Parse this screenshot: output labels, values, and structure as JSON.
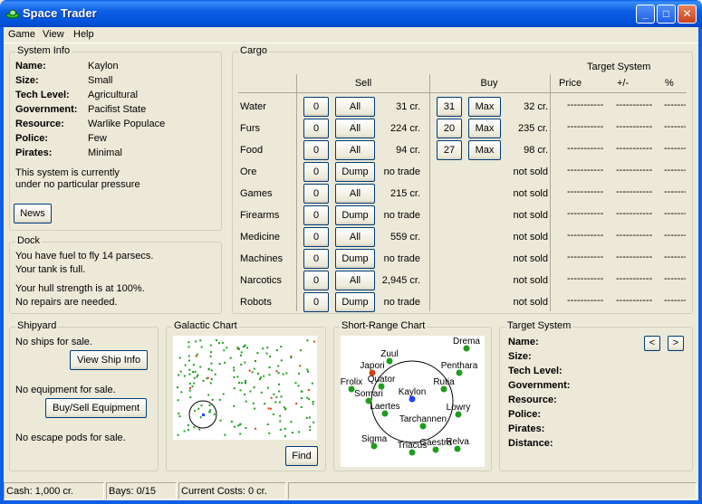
{
  "window": {
    "title": "Space Trader",
    "minimize": "_",
    "maximize": "□",
    "close": "✕"
  },
  "menu": [
    "Game",
    "View",
    "Help"
  ],
  "system_info": {
    "title": "System Info",
    "rows": [
      {
        "label": "Name:",
        "value": "Kaylon"
      },
      {
        "label": "Size:",
        "value": "Small"
      },
      {
        "label": "Tech Level:",
        "value": "Agricultural"
      },
      {
        "label": "Government:",
        "value": "Pacifist State"
      },
      {
        "label": "Resource:",
        "value": "Warlike Populace"
      },
      {
        "label": "Police:",
        "value": "Few"
      },
      {
        "label": "Pirates:",
        "value": "Minimal"
      }
    ],
    "status_line1": "This system is currently",
    "status_line2": "under no particular pressure",
    "news_button": "News"
  },
  "dock": {
    "title": "Dock",
    "fuel_text": "You have fuel to fly 14 parsecs.",
    "tank_text": "Your tank is full.",
    "hull_text": "Your hull strength is at 100%.",
    "repair_text": "No repairs are needed."
  },
  "cargo": {
    "title": "Cargo",
    "sell_header": "Sell",
    "buy_header": "Buy",
    "target_header": "Target System",
    "price_header": "Price",
    "diff_header": "+/-",
    "pct_header": "%",
    "dash": "-----------",
    "rows": [
      {
        "name": "Water",
        "sell_qty": "0",
        "sell_btn": "All",
        "sell_price": "31 cr.",
        "buy_qty": "31",
        "buy_btn": "Max",
        "buy_price": "32 cr."
      },
      {
        "name": "Furs",
        "sell_qty": "0",
        "sell_btn": "All",
        "sell_price": "224 cr.",
        "buy_qty": "20",
        "buy_btn": "Max",
        "buy_price": "235 cr."
      },
      {
        "name": "Food",
        "sell_qty": "0",
        "sell_btn": "All",
        "sell_price": "94 cr.",
        "buy_qty": "27",
        "buy_btn": "Max",
        "buy_price": "98 cr."
      },
      {
        "name": "Ore",
        "sell_qty": "0",
        "sell_btn": "Dump",
        "sell_price": "no trade",
        "buy_qty": "",
        "buy_btn": "",
        "buy_price": "not sold"
      },
      {
        "name": "Games",
        "sell_qty": "0",
        "sell_btn": "All",
        "sell_price": "215 cr.",
        "buy_qty": "",
        "buy_btn": "",
        "buy_price": "not sold"
      },
      {
        "name": "Firearms",
        "sell_qty": "0",
        "sell_btn": "Dump",
        "sell_price": "no trade",
        "buy_qty": "",
        "buy_btn": "",
        "buy_price": "not sold"
      },
      {
        "name": "Medicine",
        "sell_qty": "0",
        "sell_btn": "All",
        "sell_price": "559 cr.",
        "buy_qty": "",
        "buy_btn": "",
        "buy_price": "not sold"
      },
      {
        "name": "Machines",
        "sell_qty": "0",
        "sell_btn": "Dump",
        "sell_price": "no trade",
        "buy_qty": "",
        "buy_btn": "",
        "buy_price": "not sold"
      },
      {
        "name": "Narcotics",
        "sell_qty": "0",
        "sell_btn": "All",
        "sell_price": "2,945 cr.",
        "buy_qty": "",
        "buy_btn": "",
        "buy_price": "not sold"
      },
      {
        "name": "Robots",
        "sell_qty": "0",
        "sell_btn": "Dump",
        "sell_price": "no trade",
        "buy_qty": "",
        "buy_btn": "",
        "buy_price": "not sold"
      }
    ]
  },
  "shipyard": {
    "title": "Shipyard",
    "no_ships": "No ships for sale.",
    "view_ship_btn": "View Ship Info",
    "no_equipment": "No equipment for sale.",
    "equipment_btn": "Buy/Sell Equipment",
    "no_pods": "No escape pods for sale."
  },
  "galactic_chart": {
    "title": "Galactic Chart",
    "find_btn": "Find"
  },
  "short_range_chart": {
    "title": "Short-Range Chart",
    "systems": [
      "Drema",
      "Zuul",
      "Japori",
      "Penthara",
      "Quator",
      "Frolix",
      "Rutia",
      "Kaylon",
      "Somari",
      "Laertes",
      "Lowry",
      "Tarchannen",
      "Sigma",
      "Triacus",
      "Gaestra",
      "Relva"
    ]
  },
  "target_system": {
    "title": "Target System",
    "prev": "<",
    "next": ">",
    "labels": [
      "Name:",
      "Size:",
      "Tech Level:",
      "Government:",
      "Resource:",
      "Police:",
      "Pirates:",
      "Distance:"
    ]
  },
  "status": {
    "cash": "Cash: 1,000 cr.",
    "bays": "Bays: 0/15",
    "costs": "Current Costs: 0 cr."
  },
  "colors": {
    "star": "#1f9c1f",
    "current": "#2040ff",
    "special": "#d04010",
    "titlebar": "#0d5fe6"
  }
}
